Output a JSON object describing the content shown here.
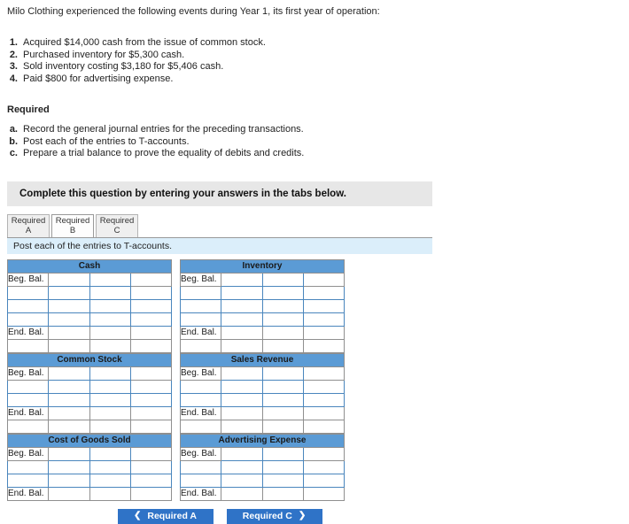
{
  "intro": {
    "statement": "Milo Clothing experienced the following events during Year 1, its first year of operation:"
  },
  "transactions": [
    {
      "num": "1.",
      "text": "Acquired $14,000 cash from the issue of common stock."
    },
    {
      "num": "2.",
      "text": "Purchased inventory for $5,300 cash."
    },
    {
      "num": "3.",
      "text": "Sold inventory costing $3,180 for $5,406 cash."
    },
    {
      "num": "4.",
      "text": "Paid $800 for advertising expense."
    }
  ],
  "required": {
    "heading": "Required",
    "items": [
      {
        "letter": "a.",
        "text": "Record the general journal entries for the preceding transactions."
      },
      {
        "letter": "b.",
        "text": "Post each of the entries to T-accounts."
      },
      {
        "letter": "c.",
        "text": "Prepare a trial balance to prove the equality of debits and credits."
      }
    ]
  },
  "banner": {
    "text": "Complete this question by entering your answers in the tabs below."
  },
  "tabs": [
    {
      "label_top": "Required",
      "label_bottom": "A",
      "selected": false
    },
    {
      "label_top": "Required",
      "label_bottom": "B",
      "selected": true
    },
    {
      "label_top": "Required",
      "label_bottom": "C",
      "selected": false
    }
  ],
  "sub_instruction": {
    "text": "Post each of the entries to T-accounts."
  },
  "labels": {
    "beg_bal": "Beg. Bal.",
    "end_bal": "End. Bal."
  },
  "accounts": [
    {
      "title": "Cash",
      "side": "left",
      "beg_bal_label": "Beg. Bal.",
      "end_bal_label": "End. Bal.",
      "entry_rows": 3,
      "values": {
        "beg_bal_debit": "",
        "beg_bal_credit": "",
        "end_bal_debit": "",
        "end_bal_credit": ""
      }
    },
    {
      "title": "Inventory",
      "side": "right",
      "beg_bal_label": "Beg. Bal.",
      "end_bal_label": "End. Bal.",
      "entry_rows": 3,
      "values": {
        "beg_bal_debit": "",
        "beg_bal_credit": "",
        "end_bal_debit": "",
        "end_bal_credit": ""
      }
    },
    {
      "title": "Common Stock",
      "side": "left",
      "beg_bal_label": "Beg. Bal.",
      "end_bal_label": "End. Bal.",
      "entry_rows": 2,
      "values": {
        "beg_bal_debit": "",
        "beg_bal_credit": "",
        "end_bal_debit": "",
        "end_bal_credit": ""
      }
    },
    {
      "title": "Sales Revenue",
      "side": "right",
      "beg_bal_label": "Beg. Bal.",
      "end_bal_label": "End. Bal.",
      "entry_rows": 2,
      "values": {
        "beg_bal_debit": "",
        "beg_bal_credit": "",
        "end_bal_debit": "",
        "end_bal_credit": ""
      }
    },
    {
      "title": "Cost of Goods Sold",
      "side": "left",
      "beg_bal_label": "Beg. Bal.",
      "end_bal_label": "End. Bal.",
      "entry_rows": 2,
      "values": {
        "beg_bal_debit": "",
        "beg_bal_credit": "",
        "end_bal_debit": "",
        "end_bal_credit": ""
      }
    },
    {
      "title": "Advertising Expense",
      "side": "right",
      "beg_bal_label": "Beg. Bal.",
      "end_bal_label": "End. Bal.",
      "entry_rows": 2,
      "values": {
        "beg_bal_debit": "",
        "beg_bal_credit": "",
        "end_bal_debit": "",
        "end_bal_credit": ""
      }
    }
  ],
  "nav": {
    "prev_label": "Required A",
    "prev_icon": "chevron-left-icon",
    "next_label": "Required C",
    "next_icon": "chevron-right-icon",
    "prev_chevron": "❮",
    "next_chevron": "❯"
  },
  "colors": {
    "header_blue": "#5b9bd5",
    "button_blue": "#2f73c7",
    "banner_grey": "#e7e7e7",
    "subinstr_blue": "#dbeefa",
    "input_border": "#4a86bd"
  }
}
